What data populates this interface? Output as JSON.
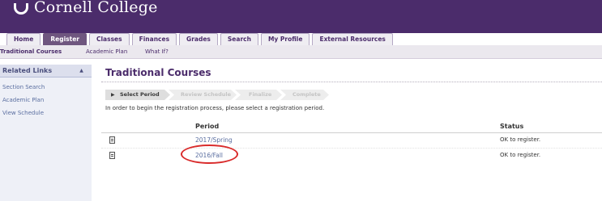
{
  "header": {
    "college_name": "Cornell College",
    "logo_icon": "shield-icon",
    "background_color": "#4b2c6b"
  },
  "tabs": [
    {
      "label": "Home",
      "active": false
    },
    {
      "label": "Register",
      "active": true
    },
    {
      "label": "Classes",
      "active": false
    },
    {
      "label": "Finances",
      "active": false
    },
    {
      "label": "Grades",
      "active": false
    },
    {
      "label": "Search",
      "active": false
    },
    {
      "label": "My Profile",
      "active": false
    },
    {
      "label": "External Resources",
      "active": false
    }
  ],
  "subnav": [
    {
      "label": "Traditional Courses",
      "active": true
    },
    {
      "label": "Academic Plan",
      "active": false
    },
    {
      "label": "What If?",
      "active": false
    }
  ],
  "sidebar": {
    "title": "Related Links",
    "collapse_icon": "triangle-up-icon",
    "links": [
      "Section Search",
      "Academic Plan",
      "View Schedule"
    ]
  },
  "main": {
    "title": "Traditional Courses",
    "steps": [
      {
        "label": "Select Period",
        "current": true
      },
      {
        "label": "Review Schedule",
        "current": false
      },
      {
        "label": "Finalize",
        "current": false
      },
      {
        "label": "Complete",
        "current": false
      }
    ],
    "instructions": "In order to begin the registration process, please select a registration period.",
    "table": {
      "columns": [
        "Period",
        "Status"
      ],
      "rows": [
        {
          "period": "2017/Spring",
          "status": "OK to register."
        },
        {
          "period": "2016/Fall",
          "status": "OK to register."
        }
      ]
    },
    "highlight_color": "#d92b2b"
  }
}
